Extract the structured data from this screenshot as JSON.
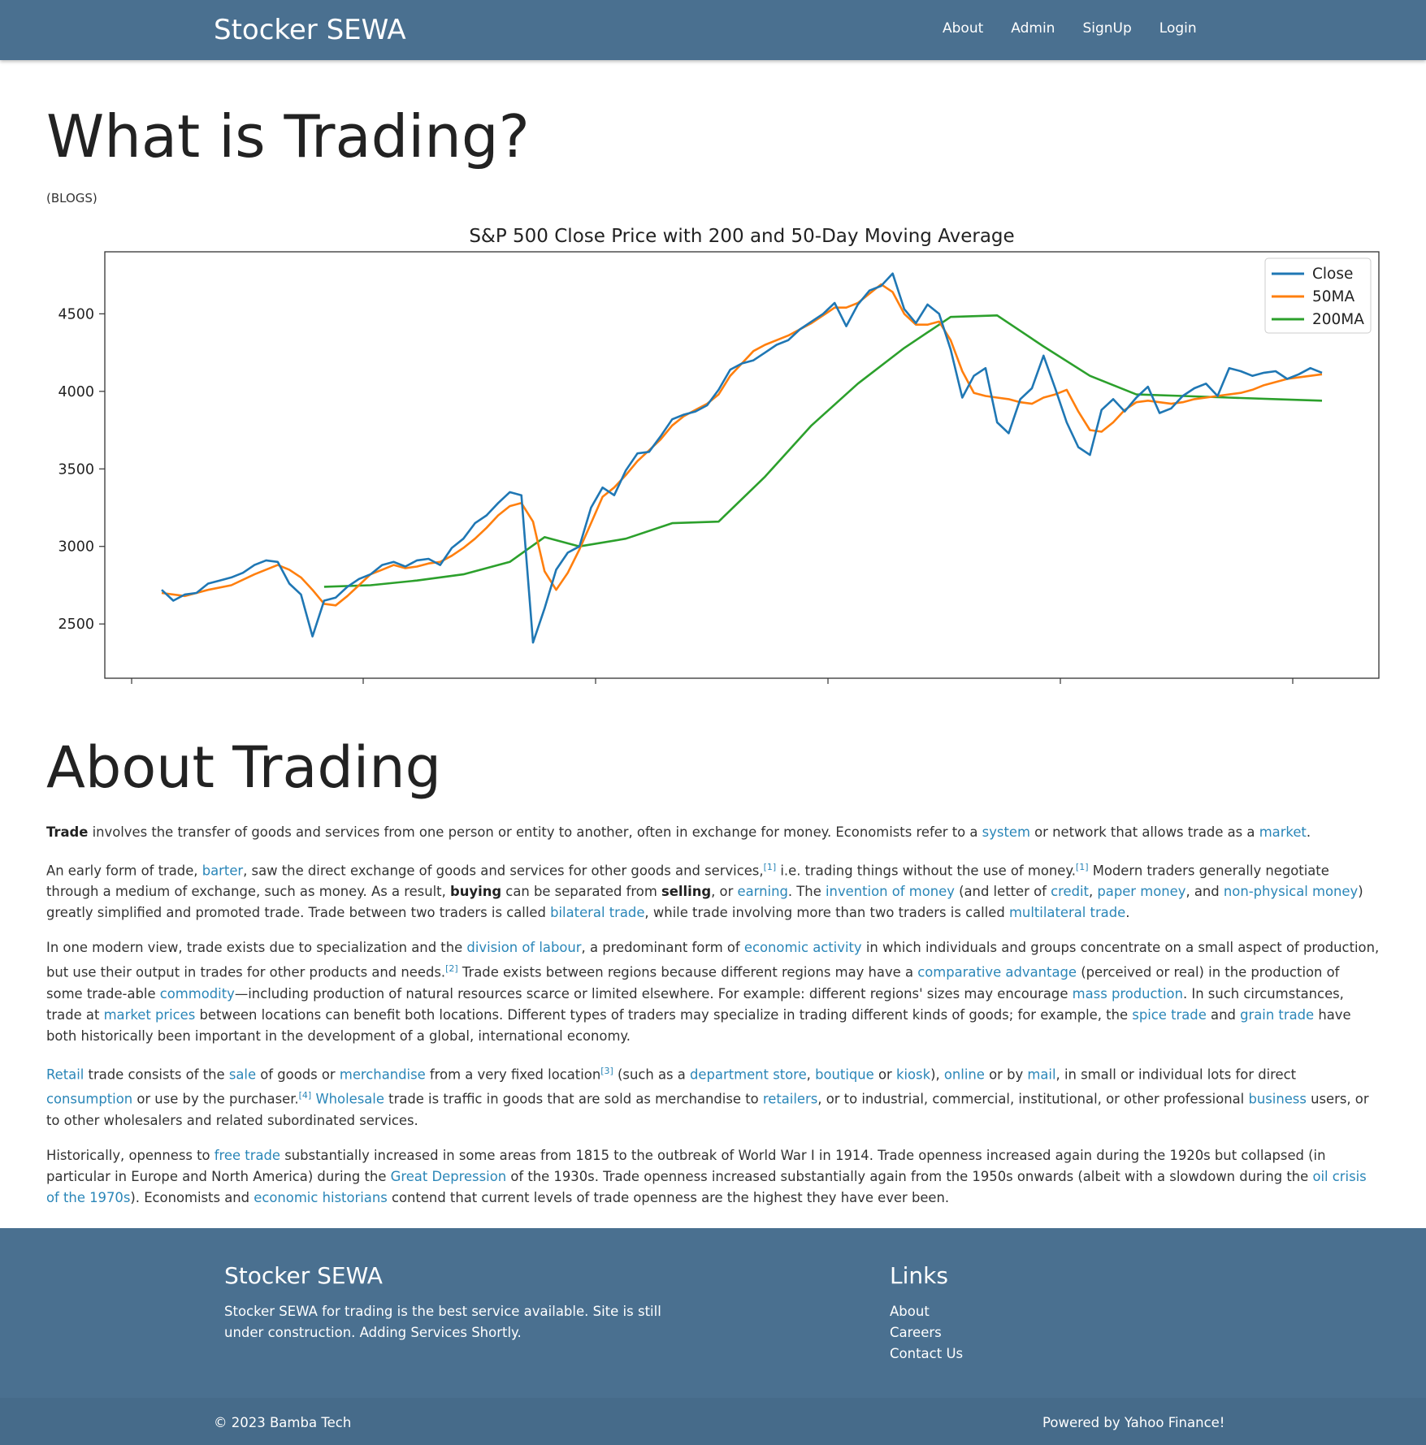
{
  "nav": {
    "brand": "Stocker SEWA",
    "links": [
      "About",
      "Admin",
      "SignUp",
      "Login"
    ]
  },
  "main": {
    "title": "What is Trading?",
    "subtitle": "(BLOGS)",
    "section_title": "About Trading"
  },
  "article": {
    "paragraphs": [
      [
        {
          "t": "Trade",
          "b": true
        },
        {
          "t": " involves the transfer of goods and services from one person or entity to another, often in exchange for money. Economists refer to a "
        },
        {
          "t": "system",
          "link": true
        },
        {
          "t": " or network that allows trade as a "
        },
        {
          "t": "market",
          "link": true
        },
        {
          "t": "."
        }
      ],
      [
        {
          "t": "An early form of trade, "
        },
        {
          "t": "barter",
          "link": true
        },
        {
          "t": ", saw the direct exchange of goods and services for other goods and services,"
        },
        {
          "t": "[1]",
          "sup": true
        },
        {
          "t": " i.e. trading things without the use of money."
        },
        {
          "t": "[1]",
          "sup": true
        },
        {
          "t": " Modern traders generally negotiate through a medium of exchange, such as money. As a result, "
        },
        {
          "t": "buying",
          "b": true
        },
        {
          "t": " can be separated from "
        },
        {
          "t": "selling",
          "b": true
        },
        {
          "t": ", or "
        },
        {
          "t": "earning",
          "link": true
        },
        {
          "t": ". The "
        },
        {
          "t": "invention of money",
          "link": true
        },
        {
          "t": " (and letter of "
        },
        {
          "t": "credit",
          "link": true
        },
        {
          "t": ", "
        },
        {
          "t": "paper money",
          "link": true
        },
        {
          "t": ", and "
        },
        {
          "t": "non-physical money",
          "link": true
        },
        {
          "t": ") greatly simplified and promoted trade. Trade between two traders is called "
        },
        {
          "t": "bilateral trade",
          "link": true
        },
        {
          "t": ", while trade involving more than two traders is called "
        },
        {
          "t": "multilateral trade",
          "link": true
        },
        {
          "t": "."
        }
      ],
      [
        {
          "t": "In one modern view, trade exists due to specialization and the "
        },
        {
          "t": "division of labour",
          "link": true
        },
        {
          "t": ", a predominant form of "
        },
        {
          "t": "economic activity",
          "link": true
        },
        {
          "t": " in which individuals and groups concentrate on a small aspect of production, but use their output in trades for other products and needs."
        },
        {
          "t": "[2]",
          "sup": true
        },
        {
          "t": " Trade exists between regions because different regions may have a "
        },
        {
          "t": "comparative advantage",
          "link": true
        },
        {
          "t": " (perceived or real) in the production of some trade-able "
        },
        {
          "t": "commodity",
          "link": true
        },
        {
          "t": "—including production of natural resources scarce or limited elsewhere. For example: different regions' sizes may encourage "
        },
        {
          "t": "mass production",
          "link": true
        },
        {
          "t": ". In such circumstances, trade at "
        },
        {
          "t": "market prices",
          "link": true
        },
        {
          "t": " between locations can benefit both locations. Different types of traders may specialize in trading different kinds of goods; for example, the "
        },
        {
          "t": "spice trade",
          "link": true
        },
        {
          "t": " and "
        },
        {
          "t": "grain trade",
          "link": true
        },
        {
          "t": " have both historically been important in the development of a global, international economy."
        }
      ],
      [
        {
          "t": "Retail",
          "link": true
        },
        {
          "t": " trade consists of the "
        },
        {
          "t": "sale",
          "link": true
        },
        {
          "t": " of goods or "
        },
        {
          "t": "merchandise",
          "link": true
        },
        {
          "t": " from a very fixed location"
        },
        {
          "t": "[3]",
          "sup": true
        },
        {
          "t": " (such as a "
        },
        {
          "t": "department store",
          "link": true
        },
        {
          "t": ", "
        },
        {
          "t": "boutique",
          "link": true
        },
        {
          "t": " or "
        },
        {
          "t": "kiosk",
          "link": true
        },
        {
          "t": "), "
        },
        {
          "t": "online",
          "link": true
        },
        {
          "t": " or by "
        },
        {
          "t": "mail",
          "link": true
        },
        {
          "t": ", in small or individual lots for direct "
        },
        {
          "t": "consumption",
          "link": true
        },
        {
          "t": " or use by the purchaser."
        },
        {
          "t": "[4]",
          "sup": true
        },
        {
          "t": " "
        },
        {
          "t": "Wholesale",
          "link": true
        },
        {
          "t": " trade is traffic in goods that are sold as merchandise to "
        },
        {
          "t": "retailers",
          "link": true
        },
        {
          "t": ", or to industrial, commercial, institutional, or other professional "
        },
        {
          "t": "business",
          "link": true
        },
        {
          "t": " users, or to other wholesalers and related subordinated services."
        }
      ],
      [
        {
          "t": "Historically, openness to "
        },
        {
          "t": "free trade",
          "link": true
        },
        {
          "t": " substantially increased in some areas from 1815 to the outbreak of World War I in 1914. Trade openness increased again during the 1920s but collapsed (in particular in Europe and North America) during the "
        },
        {
          "t": "Great Depression",
          "link": true
        },
        {
          "t": " of the 1930s. Trade openness increased substantially again from the 1950s onwards (albeit with a slowdown during the "
        },
        {
          "t": "oil crisis of the 1970s",
          "link": true
        },
        {
          "t": "). Economists and "
        },
        {
          "t": "economic historians",
          "link": true
        },
        {
          "t": " contend that current levels of trade openness are the highest they have ever been."
        }
      ]
    ]
  },
  "footer": {
    "brand": "Stocker SEWA",
    "description": "Stocker SEWA for trading is the best service available. Site is still under construction. Adding Services Shortly.",
    "links_title": "Links",
    "links": [
      "About",
      "Careers",
      "Contact Us"
    ],
    "copyright": "© 2023 Bamba Tech",
    "powered": "Powered by Yahoo Finance!"
  },
  "colors": {
    "navbar": "#4a7090",
    "link": "#2a86b8",
    "close": "#1f77b4",
    "ma50": "#ff7f0e",
    "ma200": "#2ca02c"
  },
  "chart_data": {
    "type": "line",
    "title": "S&P 500 Close Price with 200 and 50-Day Moving Average",
    "xlabel": "",
    "ylabel": "",
    "ylim": [
      2150,
      4900
    ],
    "yticks": [
      2500,
      3000,
      3500,
      4000,
      4500
    ],
    "xticks_labels": [
      "",
      "",
      "",
      "",
      "",
      ""
    ],
    "x_range": [
      0,
      100
    ],
    "legend_position": "top-right",
    "series": [
      {
        "name": "Close",
        "color": "#1f77b4",
        "x": [
          0,
          1,
          2,
          3,
          4,
          5,
          6,
          7,
          8,
          9,
          10,
          11,
          12,
          13,
          14,
          15,
          16,
          17,
          18,
          19,
          20,
          21,
          22,
          23,
          24,
          25,
          26,
          27,
          28,
          29,
          30,
          31,
          32,
          33,
          34,
          35,
          36,
          37,
          38,
          39,
          40,
          41,
          42,
          43,
          44,
          45,
          46,
          47,
          48,
          49,
          50,
          51,
          52,
          53,
          54,
          55,
          56,
          57,
          58,
          59,
          60,
          61,
          62,
          63,
          64,
          65,
          66,
          67,
          68,
          69,
          70,
          71,
          72,
          73,
          74,
          75,
          76,
          77,
          78,
          79,
          80,
          81,
          82,
          83,
          84,
          85,
          86,
          87,
          88,
          89,
          90,
          91,
          92,
          93,
          94,
          95,
          96,
          97,
          98,
          99,
          100
        ],
        "values": [
          2720,
          2650,
          2690,
          2700,
          2760,
          2780,
          2800,
          2830,
          2880,
          2910,
          2900,
          2760,
          2690,
          2420,
          2650,
          2670,
          2740,
          2790,
          2820,
          2880,
          2900,
          2870,
          2910,
          2920,
          2880,
          2990,
          3050,
          3150,
          3200,
          3280,
          3350,
          3330,
          2380,
          2600,
          2850,
          2960,
          3000,
          3250,
          3380,
          3330,
          3490,
          3600,
          3610,
          3710,
          3820,
          3850,
          3870,
          3910,
          4010,
          4140,
          4180,
          4200,
          4250,
          4300,
          4330,
          4400,
          4450,
          4500,
          4570,
          4420,
          4560,
          4650,
          4680,
          4760,
          4530,
          4440,
          4560,
          4500,
          4270,
          3960,
          4100,
          4150,
          3800,
          3730,
          3950,
          4020,
          4230,
          4020,
          3800,
          3640,
          3590,
          3880,
          3950,
          3870,
          3960,
          4030,
          3860,
          3890,
          3970,
          4020,
          4050,
          3970,
          4150,
          4130,
          4100,
          4120,
          4130,
          4080,
          4110,
          4150,
          4120
        ]
      },
      {
        "name": "50MA",
        "color": "#ff7f0e",
        "x": [
          0,
          2,
          4,
          6,
          8,
          10,
          11,
          12,
          13,
          14,
          15,
          16,
          17,
          18,
          19,
          20,
          21,
          22,
          23,
          24,
          25,
          26,
          27,
          28,
          29,
          30,
          31,
          32,
          33,
          34,
          35,
          36,
          37,
          38,
          39,
          40,
          41,
          42,
          43,
          44,
          45,
          46,
          47,
          48,
          49,
          50,
          51,
          52,
          53,
          54,
          55,
          56,
          57,
          58,
          59,
          60,
          61,
          62,
          63,
          64,
          65,
          66,
          67,
          68,
          69,
          70,
          71,
          72,
          73,
          74,
          75,
          76,
          77,
          78,
          79,
          80,
          81,
          82,
          83,
          84,
          85,
          86,
          87,
          88,
          89,
          90,
          91,
          92,
          93,
          94,
          95,
          96,
          97,
          98,
          99,
          100
        ],
        "values": [
          2700,
          2680,
          2720,
          2750,
          2820,
          2880,
          2850,
          2800,
          2720,
          2630,
          2620,
          2680,
          2750,
          2820,
          2850,
          2880,
          2860,
          2870,
          2890,
          2900,
          2940,
          2990,
          3050,
          3120,
          3200,
          3260,
          3280,
          3160,
          2840,
          2720,
          2830,
          2980,
          3150,
          3320,
          3380,
          3460,
          3550,
          3620,
          3690,
          3780,
          3840,
          3880,
          3920,
          3980,
          4100,
          4180,
          4260,
          4300,
          4330,
          4360,
          4400,
          4440,
          4490,
          4540,
          4540,
          4570,
          4630,
          4690,
          4640,
          4500,
          4430,
          4430,
          4450,
          4330,
          4130,
          3990,
          3970,
          3960,
          3950,
          3930,
          3920,
          3960,
          3980,
          4010,
          3870,
          3750,
          3740,
          3800,
          3880,
          3930,
          3940,
          3930,
          3920,
          3930,
          3950,
          3960,
          3970,
          3980,
          3990,
          4010,
          4040,
          4060,
          4080,
          4090,
          4100,
          4110
        ]
      },
      {
        "name": "200MA",
        "color": "#2ca02c",
        "x": [
          14,
          18,
          22,
          26,
          30,
          33,
          36,
          40,
          44,
          48,
          52,
          56,
          60,
          64,
          68,
          72,
          76,
          80,
          84,
          88,
          92,
          96,
          100
        ],
        "values": [
          2740,
          2750,
          2780,
          2820,
          2900,
          3060,
          3000,
          3050,
          3150,
          3160,
          3450,
          3780,
          4050,
          4280,
          4480,
          4490,
          4290,
          4100,
          3980,
          3970,
          3960,
          3950,
          3940
        ]
      }
    ]
  }
}
